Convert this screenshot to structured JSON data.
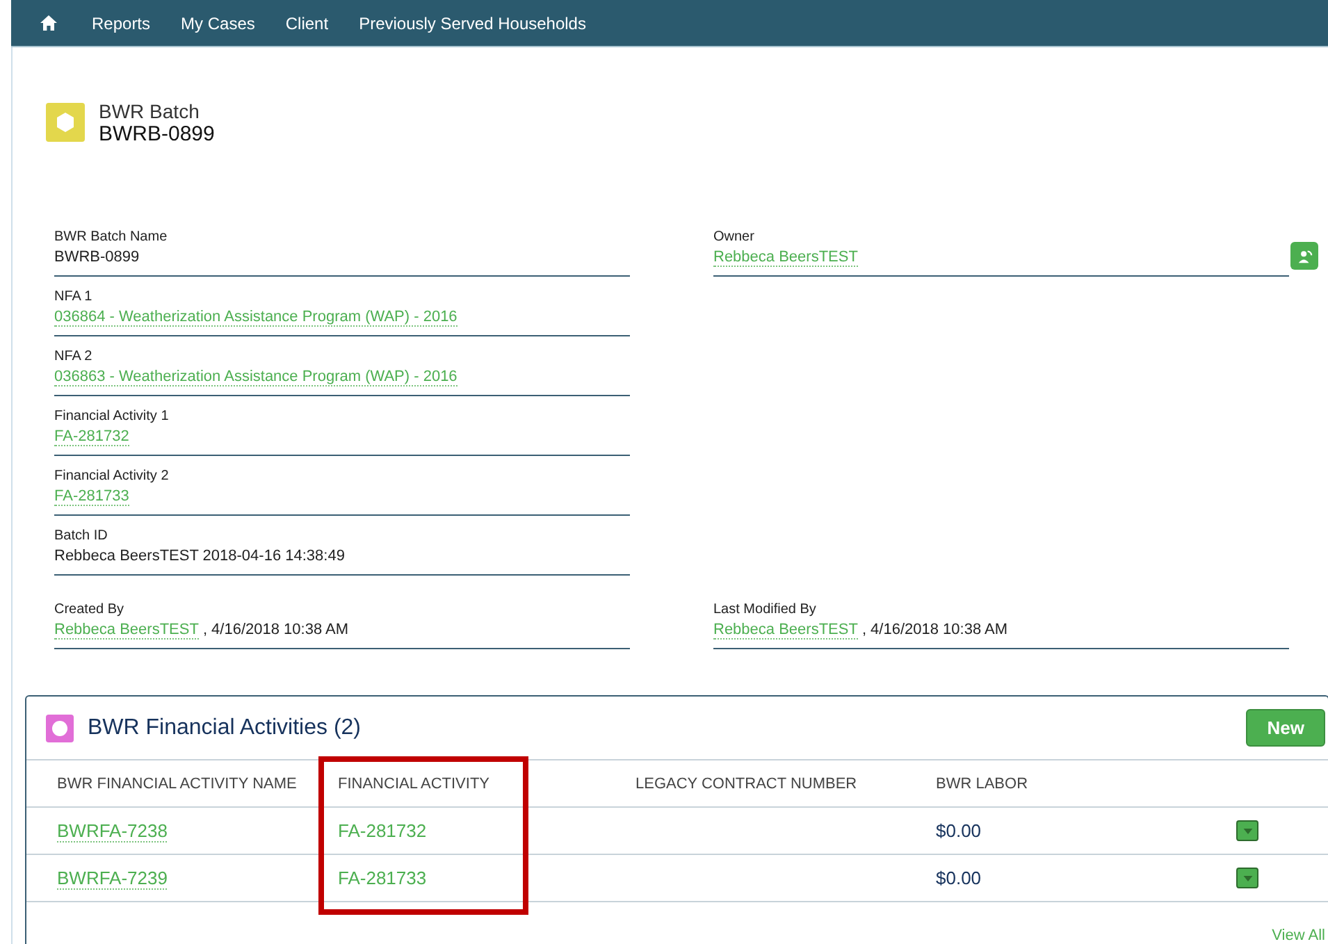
{
  "nav": {
    "items": [
      {
        "label": "Reports"
      },
      {
        "label": "My Cases"
      },
      {
        "label": "Client"
      },
      {
        "label": "Previously Served Households"
      }
    ]
  },
  "record": {
    "type": "BWR Batch",
    "name": "BWRB-0899"
  },
  "details": {
    "left": [
      {
        "label": "BWR Batch Name",
        "kind": "text",
        "value": "BWRB-0899"
      },
      {
        "label": "NFA 1",
        "kind": "link",
        "value": "036864 - Weatherization Assistance Program (WAP) - 2016"
      },
      {
        "label": "NFA 2",
        "kind": "link",
        "value": "036863 - Weatherization Assistance Program (WAP) - 2016"
      },
      {
        "label": "Financial Activity 1",
        "kind": "link",
        "value": "FA-281732"
      },
      {
        "label": "Financial Activity 2",
        "kind": "link",
        "value": "FA-281733"
      },
      {
        "label": "Batch ID",
        "kind": "text",
        "value": "Rebbeca BeersTEST 2018-04-16 14:38:49"
      }
    ],
    "right": [
      {
        "label": "Owner",
        "kind": "link",
        "value": "Rebbeca BeersTEST",
        "change_button": true
      }
    ]
  },
  "system": [
    {
      "label": "Created By",
      "kind": "link",
      "value": "Rebbeca BeersTEST",
      "suffix": ", 4/16/2018 10:38 AM"
    },
    {
      "label": "Last Modified By",
      "kind": "link",
      "value": "Rebbeca BeersTEST",
      "suffix": ", 4/16/2018 10:38 AM"
    }
  ],
  "related": {
    "title": "BWR Financial Activities (2)",
    "new_button": "New",
    "columns": [
      {
        "label": "BWR FINANCIAL ACTIVITY NAME",
        "highlighted": false
      },
      {
        "label": "FINANCIAL ACTIVITY",
        "highlighted": true
      },
      {
        "label": "LEGACY CONTRACT NUMBER",
        "highlighted": false
      },
      {
        "label": "BWR LABOR",
        "highlighted": false
      }
    ],
    "rows": [
      {
        "name": "BWRFA-7238",
        "financial_activity": "FA-281732",
        "bwr_labor": "$0.00"
      },
      {
        "name": "BWRFA-7239",
        "financial_activity": "FA-281733",
        "bwr_labor": "$0.00"
      }
    ],
    "view_all": "View All"
  }
}
